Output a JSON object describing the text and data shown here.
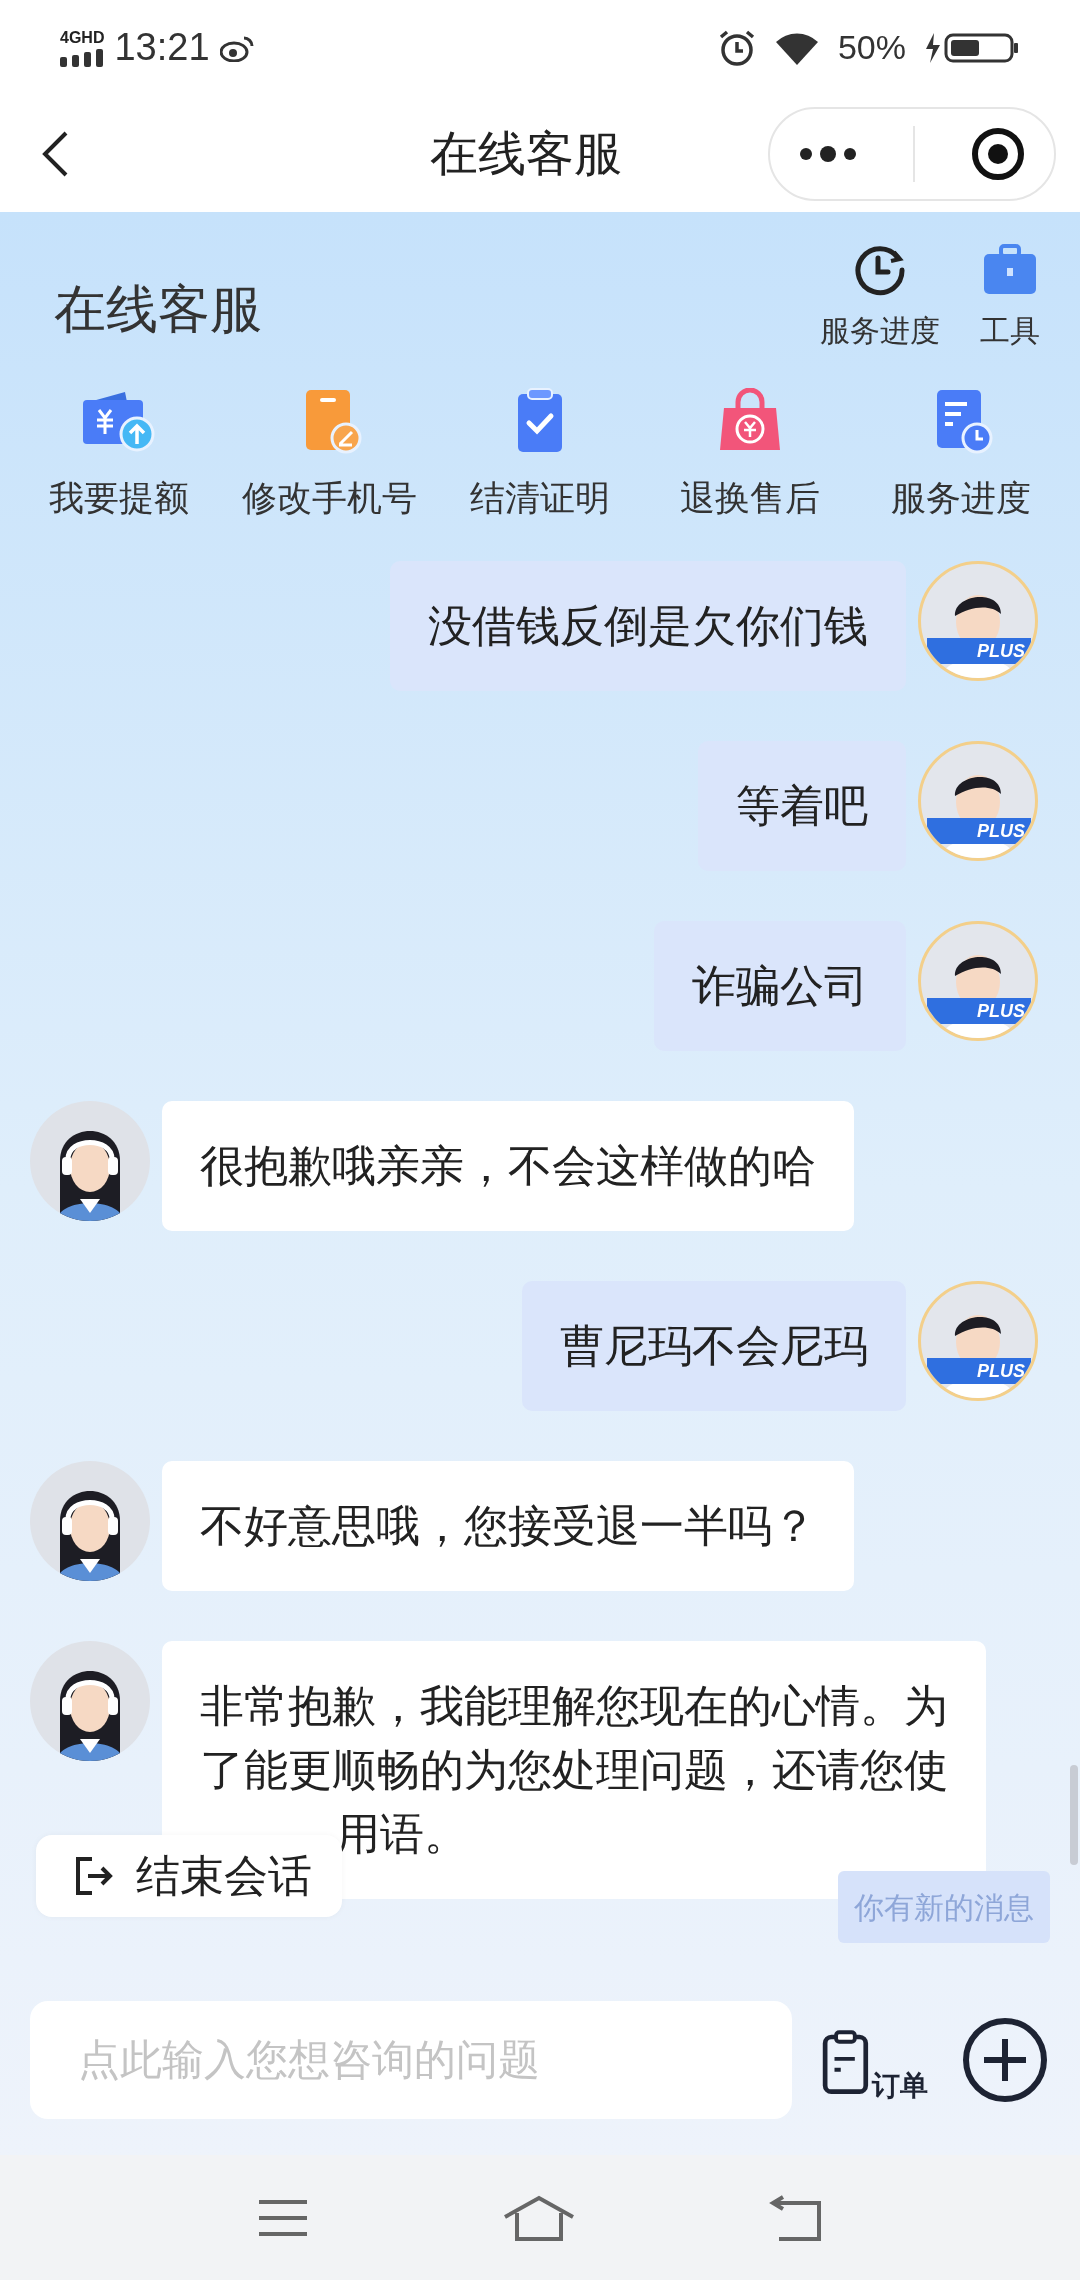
{
  "status_bar": {
    "network": "4GHD",
    "time": "13:21",
    "battery": "50%"
  },
  "nav": {
    "title": "在线客服"
  },
  "header": {
    "title": "在线客服",
    "tools": [
      {
        "label": "服务进度",
        "kind": "clock"
      },
      {
        "label": "工具",
        "kind": "toolbox"
      }
    ]
  },
  "shortcuts": [
    {
      "label": "我要提额",
      "kind": "wallet"
    },
    {
      "label": "修改手机号",
      "kind": "phone"
    },
    {
      "label": "结清证明",
      "kind": "clipboard"
    },
    {
      "label": "退换售后",
      "kind": "bag"
    },
    {
      "label": "服务进度",
      "kind": "document"
    }
  ],
  "messages": [
    {
      "kind": "user",
      "lines": [
        "没借钱反倒是欠你们钱"
      ],
      "badge": "PLUS"
    },
    {
      "kind": "user",
      "lines": [
        "等着吧"
      ],
      "badge": "PLUS"
    },
    {
      "kind": "user",
      "lines": [
        "诈骗公司"
      ],
      "badge": "PLUS"
    },
    {
      "kind": "agent",
      "lines": [
        "很抱歉哦亲亲，不会这样做的哈"
      ]
    },
    {
      "kind": "user",
      "lines": [
        "曹尼玛不会尼玛"
      ],
      "badge": "PLUS"
    },
    {
      "kind": "agent",
      "lines": [
        "不好意思哦，您接受退一半吗？"
      ]
    },
    {
      "kind": "agent",
      "lines": [
        "非常抱歉，我能理解您现在的心情。为",
        "了能更顺畅的为您处理问题，还请您使",
        "用语。"
      ],
      "partially_covered": true
    }
  ],
  "end_session": "结束会话",
  "new_message_notice": "你有新的消息",
  "input": {
    "placeholder": "点此输入您想咨询的问题"
  },
  "order_button": "订单"
}
